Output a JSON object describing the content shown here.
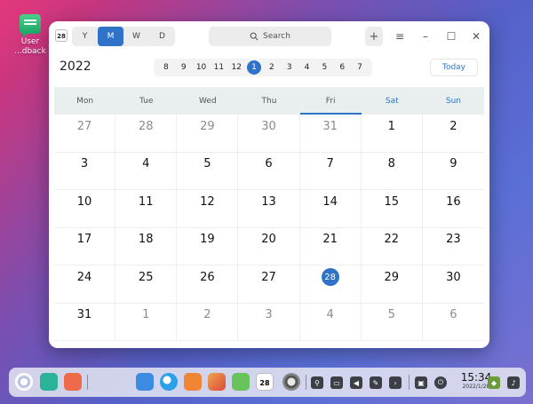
{
  "desktop": {
    "icon_label_line1": "User",
    "icon_label_line2": "...dback"
  },
  "window": {
    "app_badge": "28",
    "views": [
      {
        "label": "Y",
        "active": false
      },
      {
        "label": "M",
        "active": true
      },
      {
        "label": "W",
        "active": false
      },
      {
        "label": "D",
        "active": false
      }
    ],
    "search_placeholder": "Search",
    "add_label": "+",
    "menu_label": "≡",
    "minimize_label": "–",
    "maximize_label": "☐",
    "close_label": "✕",
    "year": "2022",
    "months": [
      "8",
      "9",
      "10",
      "11",
      "12",
      "1",
      "2",
      "3",
      "4",
      "5",
      "6",
      "7"
    ],
    "current_month": "1",
    "today_label": "Today"
  },
  "calendar": {
    "weekdays": [
      "Mon",
      "Tue",
      "Wed",
      "Thu",
      "Fri",
      "Sat",
      "Sun"
    ],
    "weekend_color": "#2f73c9",
    "accent_color": "#2f73c9",
    "weeks": [
      [
        {
          "d": "27",
          "o": true
        },
        {
          "d": "28",
          "o": true
        },
        {
          "d": "29",
          "o": true
        },
        {
          "d": "30",
          "o": true
        },
        {
          "d": "31",
          "o": true
        },
        {
          "d": "1"
        },
        {
          "d": "2"
        }
      ],
      [
        {
          "d": "3"
        },
        {
          "d": "4"
        },
        {
          "d": "5"
        },
        {
          "d": "6"
        },
        {
          "d": "7"
        },
        {
          "d": "8"
        },
        {
          "d": "9"
        }
      ],
      [
        {
          "d": "10"
        },
        {
          "d": "11"
        },
        {
          "d": "12"
        },
        {
          "d": "13"
        },
        {
          "d": "14"
        },
        {
          "d": "15"
        },
        {
          "d": "16"
        }
      ],
      [
        {
          "d": "17"
        },
        {
          "d": "18"
        },
        {
          "d": "19"
        },
        {
          "d": "20"
        },
        {
          "d": "21"
        },
        {
          "d": "22"
        },
        {
          "d": "23"
        }
      ],
      [
        {
          "d": "24"
        },
        {
          "d": "25"
        },
        {
          "d": "26"
        },
        {
          "d": "27"
        },
        {
          "d": "28",
          "today": true
        },
        {
          "d": "29"
        },
        {
          "d": "30"
        }
      ],
      [
        {
          "d": "31"
        },
        {
          "d": "1",
          "o": true
        },
        {
          "d": "2",
          "o": true
        },
        {
          "d": "3",
          "o": true
        },
        {
          "d": "4",
          "o": true
        },
        {
          "d": "5",
          "o": true
        },
        {
          "d": "6",
          "o": true
        }
      ]
    ]
  },
  "dock": {
    "calendar_badge": "28",
    "time": "15:34",
    "date": "2022/1/28"
  }
}
